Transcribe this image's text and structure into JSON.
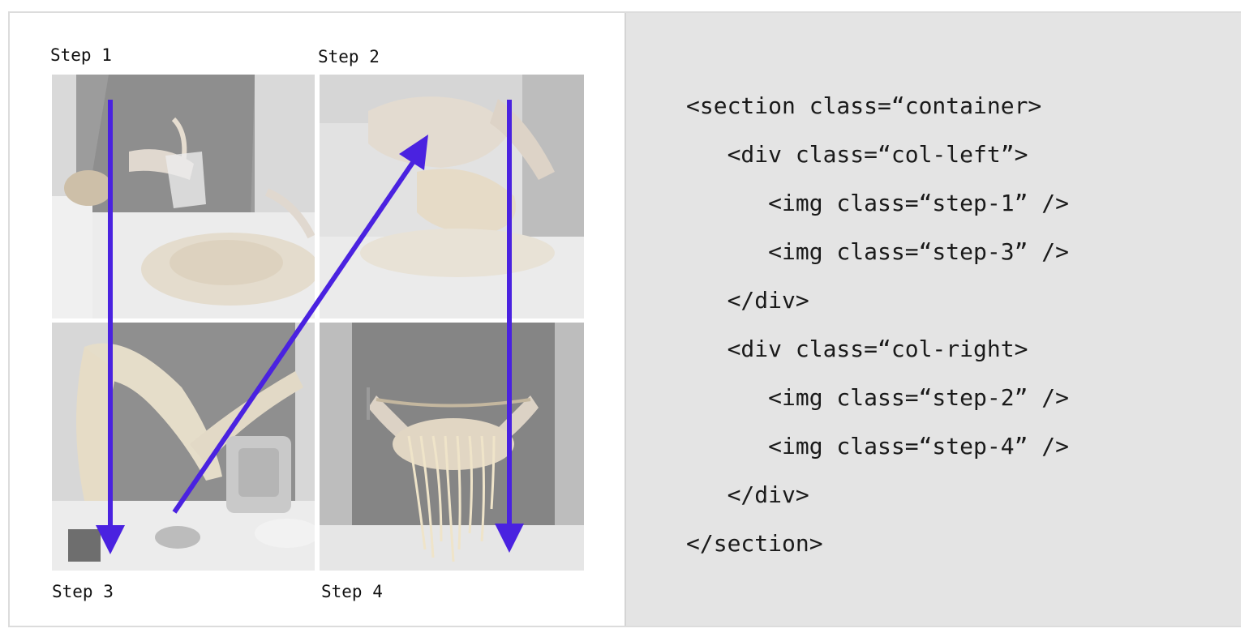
{
  "steps": {
    "step1": "Step 1",
    "step2": "Step 2",
    "step3": "Step 3",
    "step4": "Step 4"
  },
  "code": {
    "lines": [
      "<section class=“container>",
      "   <div class=“col-left”>",
      "      <img class=“step-1” />",
      "      <img class=“step-3” />",
      "   </div>",
      "   <div class=“col-right>",
      "      <img class=“step-2” />",
      "      <img class=“step-4” />",
      "   </div>",
      "</section>"
    ]
  },
  "colors": {
    "arrow": "#4a22e0",
    "code_panel_bg": "#e4e4e4",
    "border": "#dcdcdc"
  },
  "icons": {
    "step1_photo": "pouring-water-on-flour-photo",
    "step2_photo": "kneading-dough-photo",
    "step3_photo": "rolling-pasta-sheet-photo",
    "step4_photo": "holding-fresh-noodles-photo"
  }
}
